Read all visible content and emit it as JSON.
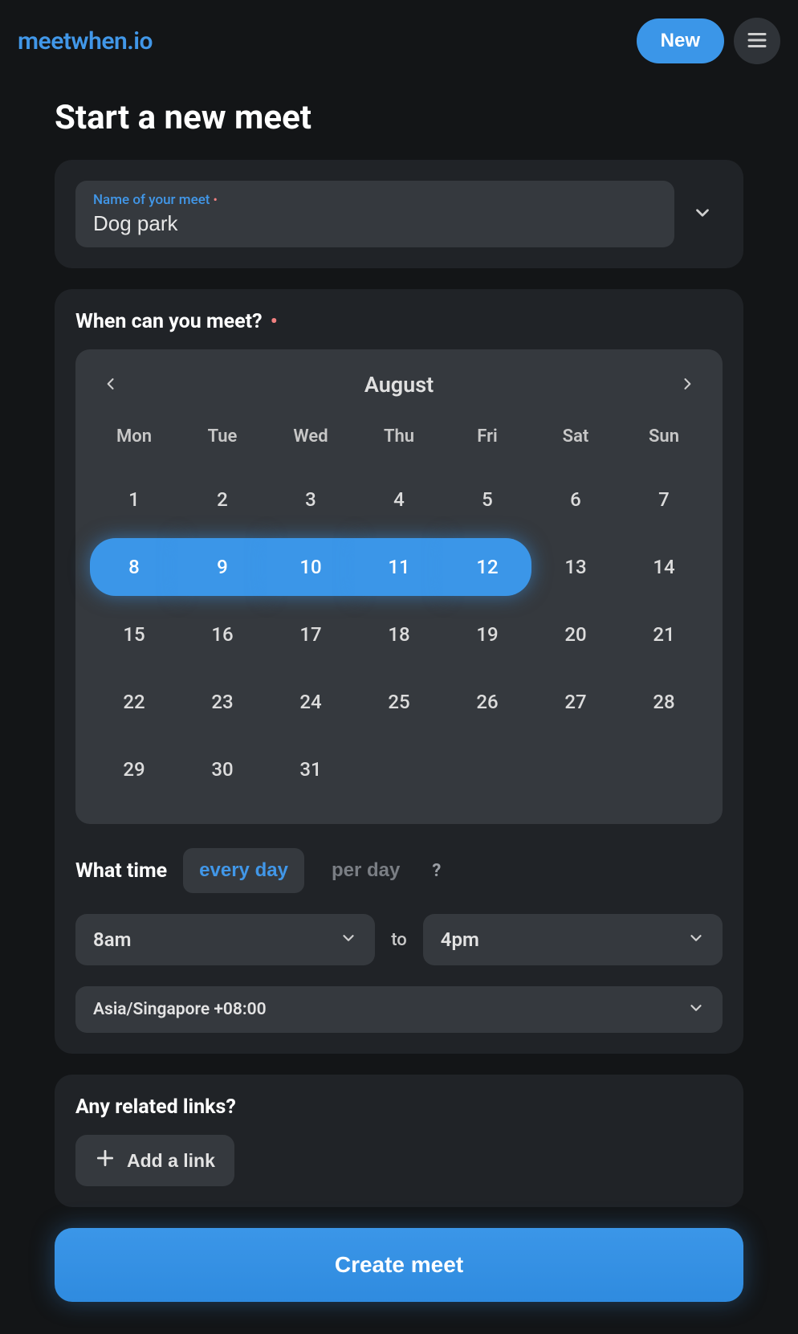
{
  "header": {
    "logo": "meetwhen.io",
    "new_label": "New"
  },
  "title": "Start a new meet",
  "name_card": {
    "label": "Name of your meet",
    "value": "Dog park"
  },
  "when": {
    "heading": "When can you meet?",
    "month": "August",
    "dow": [
      "Mon",
      "Tue",
      "Wed",
      "Thu",
      "Fri",
      "Sat",
      "Sun"
    ],
    "days": [
      {
        "n": "1"
      },
      {
        "n": "2"
      },
      {
        "n": "3"
      },
      {
        "n": "4"
      },
      {
        "n": "5"
      },
      {
        "n": "6"
      },
      {
        "n": "7"
      },
      {
        "n": "8",
        "sel": true,
        "pos": "start"
      },
      {
        "n": "9",
        "sel": true
      },
      {
        "n": "10",
        "sel": true
      },
      {
        "n": "11",
        "sel": true
      },
      {
        "n": "12",
        "sel": true,
        "pos": "end"
      },
      {
        "n": "13"
      },
      {
        "n": "14"
      },
      {
        "n": "15"
      },
      {
        "n": "16"
      },
      {
        "n": "17"
      },
      {
        "n": "18"
      },
      {
        "n": "19"
      },
      {
        "n": "20"
      },
      {
        "n": "21"
      },
      {
        "n": "22"
      },
      {
        "n": "23"
      },
      {
        "n": "24"
      },
      {
        "n": "25"
      },
      {
        "n": "26"
      },
      {
        "n": "27"
      },
      {
        "n": "28"
      },
      {
        "n": "29"
      },
      {
        "n": "30"
      },
      {
        "n": "31"
      }
    ],
    "time_label": "What time",
    "mode_every": "every day",
    "mode_per": "per day",
    "help": "?",
    "from": "8am",
    "to_label": "to",
    "to": "4pm",
    "tz": "Asia/Singapore +08:00"
  },
  "links": {
    "heading": "Any related links?",
    "add_label": "Add a link"
  },
  "create_label": "Create meet"
}
